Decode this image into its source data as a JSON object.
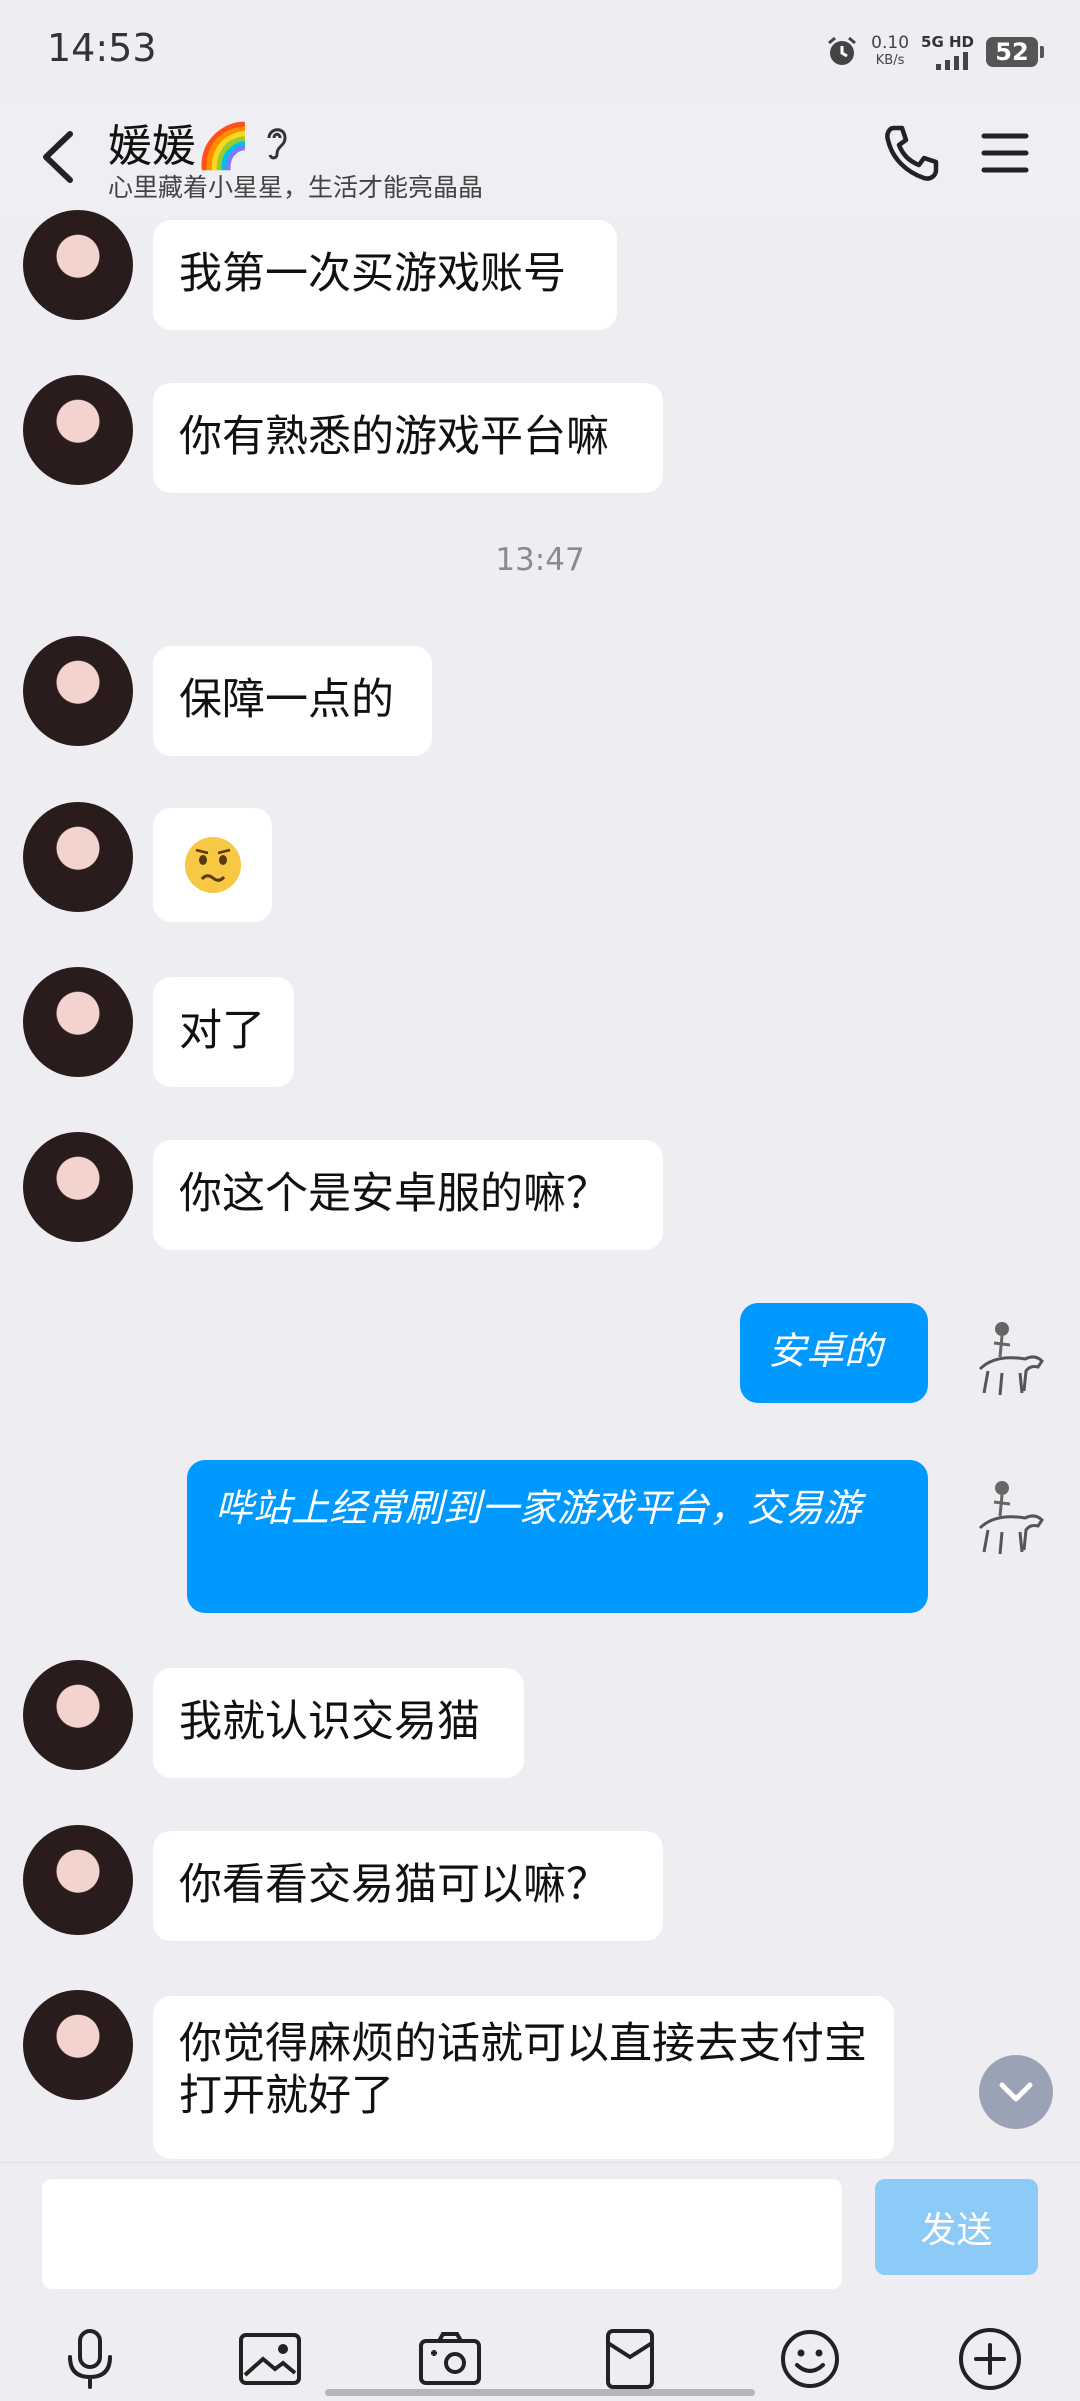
{
  "status_bar": {
    "time": "14:53",
    "net_speed": "0.10",
    "net_unit": "KB/s",
    "network": "5G HD",
    "battery": "52"
  },
  "header": {
    "contact_name": "媛媛🌈",
    "signature": "心里藏着小星星，生活才能亮晶晶"
  },
  "messages": [
    {
      "from": "them",
      "text": "我第一次买游戏账号"
    },
    {
      "from": "them",
      "text": "你有熟悉的游戏平台嘛"
    },
    {
      "type": "timestamp",
      "text": "13:47"
    },
    {
      "from": "them",
      "text": "保障一点的"
    },
    {
      "from": "them",
      "type": "emoji",
      "icon": "worried-face-emoji"
    },
    {
      "from": "them",
      "text": "对了"
    },
    {
      "from": "them",
      "text": "你这个是安卓服的嘛？"
    },
    {
      "from": "me",
      "text": "安卓的"
    },
    {
      "from": "me",
      "text": "哔站上经常刷到一家游戏平台，交易游"
    },
    {
      "from": "them",
      "text": "我就认识交易猫"
    },
    {
      "from": "them",
      "text": "你看看交易猫可以嘛？"
    },
    {
      "from": "them",
      "text": "你觉得麻烦的话就可以直接去支付宝打开就好了"
    }
  ],
  "input": {
    "value": "",
    "send_label": "发送"
  },
  "colors": {
    "my_bubble": "#0099ff",
    "their_bubble": "#ffffff",
    "background": "#ededf2",
    "send_disabled": "#8ccaf7"
  },
  "toolbar_icons": [
    "microphone-icon",
    "image-icon",
    "camera-icon",
    "red-packet-icon",
    "emoji-icon",
    "plus-icon"
  ]
}
